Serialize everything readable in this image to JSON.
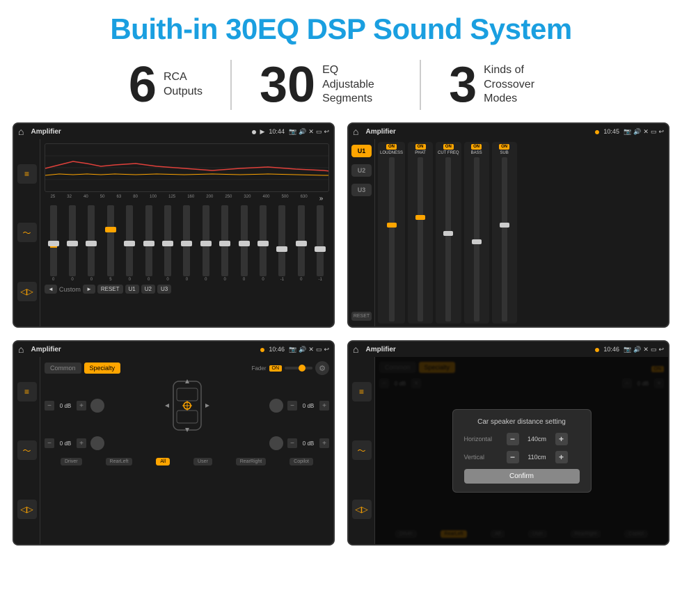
{
  "header": {
    "title": "Buith-in 30EQ DSP Sound System"
  },
  "stats": [
    {
      "number": "6",
      "label": "RCA\nOutputs"
    },
    {
      "number": "30",
      "label": "EQ Adjustable\nSegments"
    },
    {
      "number": "3",
      "label": "Kinds of\nCrossover Modes"
    }
  ],
  "screens": {
    "eq": {
      "title": "Amplifier",
      "time": "10:44",
      "freqs": [
        "25",
        "32",
        "40",
        "50",
        "63",
        "80",
        "100",
        "125",
        "160",
        "200",
        "250",
        "320",
        "400",
        "500",
        "630"
      ],
      "values": [
        "0",
        "0",
        "0",
        "5",
        "0",
        "0",
        "0",
        "0",
        "0",
        "0",
        "0",
        "0",
        "-1",
        "0",
        "-1"
      ],
      "bottom_buttons": [
        "Custom",
        "RESET",
        "U1",
        "U2",
        "U3"
      ]
    },
    "amp": {
      "title": "Amplifier",
      "time": "10:45",
      "controls": [
        "LOUDNESS",
        "PHAT",
        "CUT FREQ",
        "BASS",
        "SUB"
      ],
      "u_buttons": [
        "U1",
        "U2",
        "U3"
      ]
    },
    "crossover": {
      "title": "Amplifier",
      "time": "10:46",
      "tabs": [
        "Common",
        "Specialty"
      ],
      "fader_label": "Fader",
      "bottom_buttons": [
        "Driver",
        "RearLeft",
        "All",
        "User",
        "RearRight",
        "Copilot"
      ],
      "db_values": [
        "0 dB",
        "0 dB",
        "0 dB",
        "0 dB"
      ]
    },
    "dialog": {
      "title": "Amplifier",
      "time": "10:46",
      "dialog_title": "Car speaker distance setting",
      "horizontal_label": "Horizontal",
      "horizontal_value": "140cm",
      "vertical_label": "Vertical",
      "vertical_value": "110cm",
      "confirm_label": "Confirm",
      "bottom_buttons": [
        "Driver",
        "RearLeft",
        "All",
        "User",
        "RearRight",
        "Copilot"
      ],
      "db_values": [
        "0 dB",
        "0 dB"
      ]
    }
  }
}
